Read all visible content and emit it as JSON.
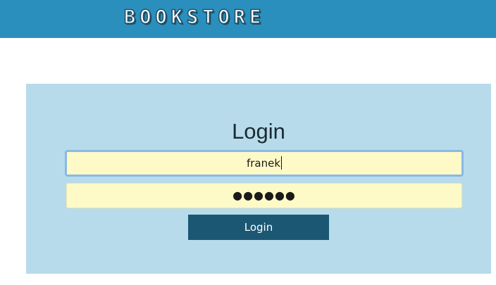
{
  "header": {
    "logo_text": "BOOKSTORE",
    "background": "#2b8fbe"
  },
  "login": {
    "title": "Login",
    "username_value": "franek",
    "password_masked": "●●●●●●",
    "submit_label": "Login",
    "panel_background": "#b7dbea",
    "field_background": "#fefac8",
    "button_background": "#1b5773"
  }
}
